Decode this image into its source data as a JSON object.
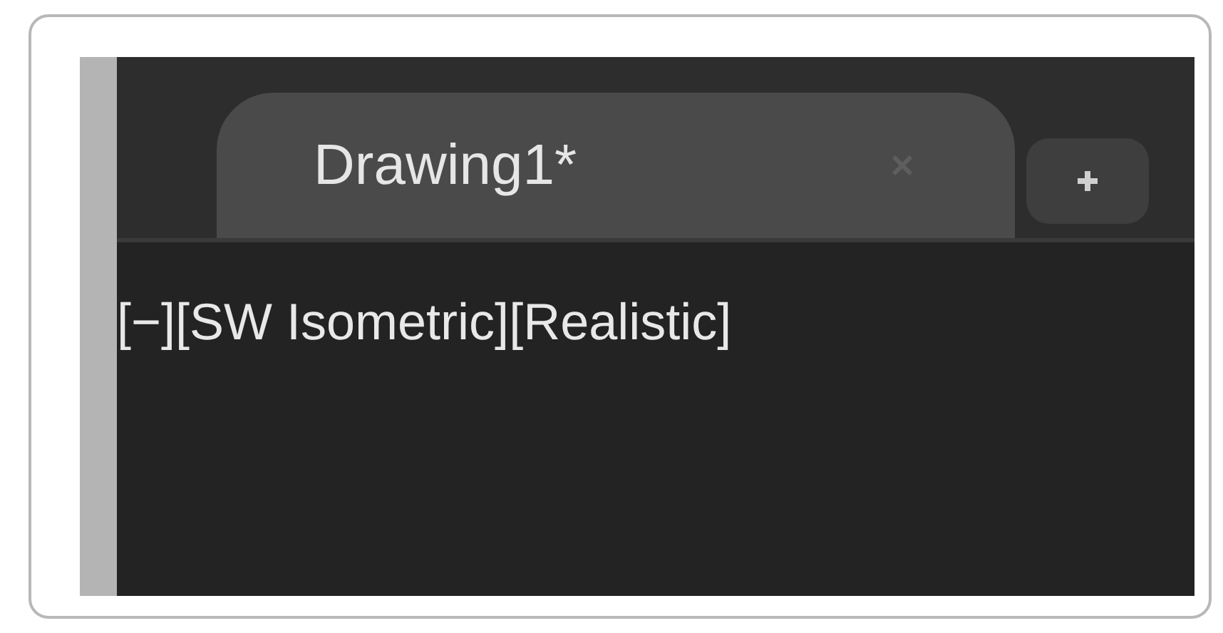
{
  "tabs": [
    {
      "label": "Drawing1*",
      "selected": true
    }
  ],
  "viewport_controls": [
    "[−]",
    "[SW Isometric]",
    "[Realistic]"
  ]
}
